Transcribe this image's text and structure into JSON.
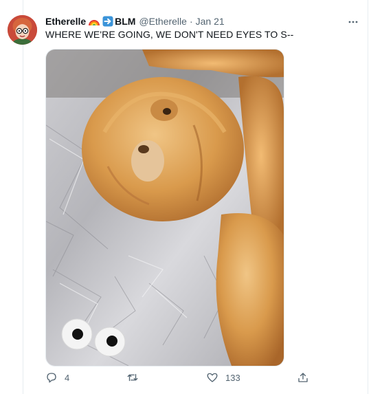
{
  "tweet": {
    "display_name": "Etherelle",
    "name_suffix": "BLM",
    "handle": "@Etherelle",
    "separator": "·",
    "date": "Jan 21",
    "text": "WHERE WE'RE GOING, WE DON'T NEED EYES TO S--",
    "emojis": [
      "rainbow-emoji",
      "arrow-right-emoji"
    ],
    "icons": {
      "more": "more-horizontal-icon",
      "reply": "reply-icon",
      "retweet": "retweet-icon",
      "like": "heart-icon",
      "share": "share-icon"
    }
  },
  "actions": {
    "reply_count": "4",
    "retweet_count": "",
    "like_count": "133"
  },
  "colors": {
    "text_primary": "#0f1419",
    "text_secondary": "#536471",
    "divider": "#e6ecf0"
  }
}
